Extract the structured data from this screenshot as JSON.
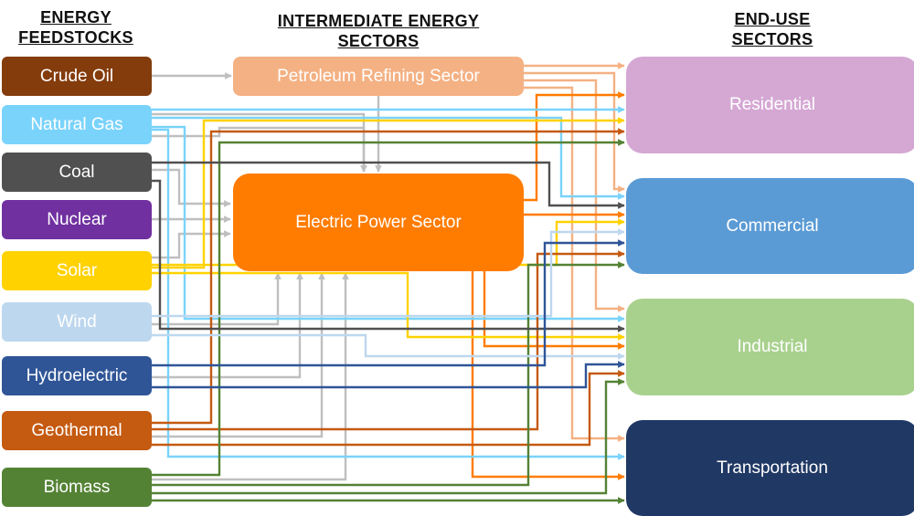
{
  "headings": {
    "feedstocks": [
      "ENERGY",
      "FEEDSTOCKS"
    ],
    "intermediate": [
      "INTERMEDIATE ENERGY",
      "SECTORS"
    ],
    "end_use": [
      "END-USE",
      "SECTORS"
    ]
  },
  "feedstocks": [
    {
      "id": "crude",
      "label": "Crude Oil",
      "color": "#843C0C"
    },
    {
      "id": "gas",
      "label": "Natural Gas",
      "color": "#7AD3FB"
    },
    {
      "id": "coal",
      "label": "Coal",
      "color": "#505050"
    },
    {
      "id": "nuclear",
      "label": "Nuclear",
      "color": "#7030A0"
    },
    {
      "id": "solar",
      "label": "Solar",
      "color": "#FFD200"
    },
    {
      "id": "wind",
      "label": "Wind",
      "color": "#BDD7EE"
    },
    {
      "id": "hydro",
      "label": "Hydroelectric",
      "color": "#2F5597"
    },
    {
      "id": "geo",
      "label": "Geothermal",
      "color": "#C55A11"
    },
    {
      "id": "bio",
      "label": "Biomass",
      "color": "#548235"
    }
  ],
  "intermediate": [
    {
      "id": "refining",
      "label": "Petroleum Refining Sector",
      "color": "#F4B183"
    },
    {
      "id": "power",
      "label": "Electric Power Sector",
      "color": "#FF7C00"
    }
  ],
  "end_use": [
    {
      "id": "res",
      "label": "Residential",
      "color": "#D5A8D4"
    },
    {
      "id": "com",
      "label": "Commercial",
      "color": "#5B9BD5"
    },
    {
      "id": "ind",
      "label": "Industrial",
      "color": "#A9D18E"
    },
    {
      "id": "trn",
      "label": "Transportation",
      "color": "#203864"
    }
  ],
  "connector_color_to_power": "#BFBFBF",
  "flows": [
    {
      "from": "crude",
      "to": "refining"
    },
    {
      "from": "gas",
      "to": "refining"
    },
    {
      "from": "coal",
      "to": "power"
    },
    {
      "from": "nuclear",
      "to": "power"
    },
    {
      "from": "solar",
      "to": "power"
    },
    {
      "from": "wind",
      "to": "power"
    },
    {
      "from": "hydro",
      "to": "power"
    },
    {
      "from": "geo",
      "to": "power"
    },
    {
      "from": "bio",
      "to": "power"
    },
    {
      "from": "gas",
      "to": "power"
    },
    {
      "from": "refining",
      "to": "power"
    },
    {
      "from": "refining",
      "to": "res"
    },
    {
      "from": "refining",
      "to": "com"
    },
    {
      "from": "refining",
      "to": "ind"
    },
    {
      "from": "refining",
      "to": "trn"
    },
    {
      "from": "power",
      "to": "res"
    },
    {
      "from": "power",
      "to": "com"
    },
    {
      "from": "power",
      "to": "ind"
    },
    {
      "from": "power",
      "to": "trn"
    },
    {
      "from": "gas",
      "to": "res"
    },
    {
      "from": "gas",
      "to": "com"
    },
    {
      "from": "gas",
      "to": "ind"
    },
    {
      "from": "gas",
      "to": "trn"
    },
    {
      "from": "solar",
      "to": "res"
    },
    {
      "from": "solar",
      "to": "com"
    },
    {
      "from": "solar",
      "to": "ind"
    },
    {
      "from": "geo",
      "to": "res"
    },
    {
      "from": "geo",
      "to": "com"
    },
    {
      "from": "geo",
      "to": "ind"
    },
    {
      "from": "bio",
      "to": "res"
    },
    {
      "from": "bio",
      "to": "com"
    },
    {
      "from": "bio",
      "to": "ind"
    },
    {
      "from": "bio",
      "to": "trn"
    },
    {
      "from": "coal",
      "to": "com"
    },
    {
      "from": "coal",
      "to": "ind"
    },
    {
      "from": "wind",
      "to": "com"
    },
    {
      "from": "wind",
      "to": "ind"
    },
    {
      "from": "hydro",
      "to": "com"
    },
    {
      "from": "hydro",
      "to": "ind"
    }
  ]
}
